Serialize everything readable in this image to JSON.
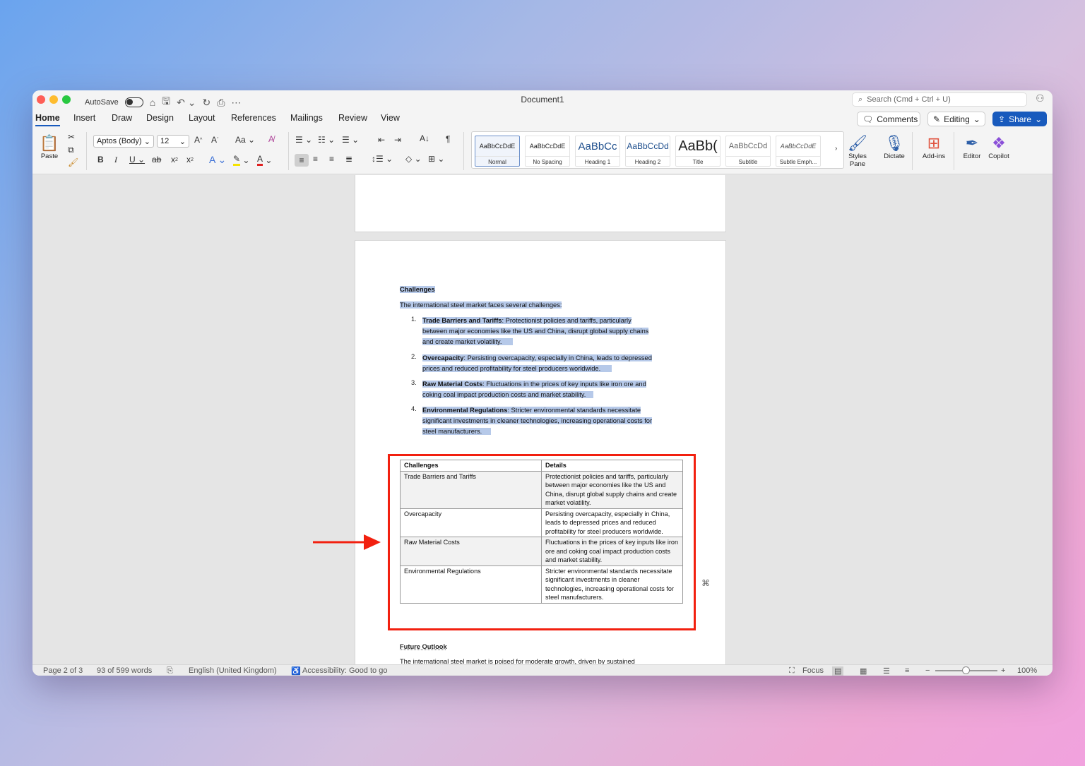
{
  "window": {
    "title": "Document1",
    "autosave_label": "AutoSave",
    "search_placeholder": "Search (Cmd + Ctrl + U)"
  },
  "menu": {
    "tabs": [
      "Home",
      "Insert",
      "Draw",
      "Design",
      "Layout",
      "References",
      "Mailings",
      "Review",
      "View"
    ],
    "comments_label": "Comments",
    "editing_label": "Editing",
    "share_label": "Share"
  },
  "ribbon": {
    "paste_label": "Paste",
    "font_name": "Aptos (Body)",
    "font_size": "12",
    "case_label": "Aa",
    "styles": [
      {
        "preview": "AaBbCcDdE",
        "label": "Normal"
      },
      {
        "preview": "AaBbCcDdE",
        "label": "No Spacing"
      },
      {
        "preview": "AaBbCc",
        "label": "Heading 1"
      },
      {
        "preview": "AaBbCcDd",
        "label": "Heading 2"
      },
      {
        "preview": "AaBb(",
        "label": "Title"
      },
      {
        "preview": "AaBbCcDd",
        "label": "Subtitle"
      },
      {
        "preview": "AaBbCcDdE",
        "label": "Subtle Emph..."
      }
    ],
    "styles_pane_label": "Styles Pane",
    "dictate_label": "Dictate",
    "addins_label": "Add-ins",
    "editor_label": "Editor",
    "copilot_label": "Copilot"
  },
  "document": {
    "heading": "Challenges",
    "intro": "The international steel market faces several challenges:",
    "list": [
      {
        "num": "1.",
        "bold": "Trade Barriers and Tariffs",
        "lines": [
          ": Protectionist policies and tariffs, particularly",
          "between major economies like the US and China, disrupt global supply chains",
          "and create market volatility."
        ]
      },
      {
        "num": "2.",
        "bold": "Overcapacity",
        "lines": [
          ": Persisting overcapacity, especially in China, leads to depressed",
          "prices and reduced profitability for steel producers worldwide."
        ]
      },
      {
        "num": "3.",
        "bold": "Raw Material Costs",
        "lines": [
          ": Fluctuations in the prices of key inputs like iron ore and",
          "coking coal impact production costs and market stability."
        ]
      },
      {
        "num": "4.",
        "bold": "Environmental Regulations",
        "lines": [
          ": Stricter environmental standards necessitate",
          "significant investments in cleaner technologies, increasing operational costs for",
          "steel manufacturers."
        ]
      }
    ],
    "table": {
      "headers": [
        "Challenges",
        "Details"
      ],
      "rows": [
        [
          "Trade Barriers and Tariffs",
          "Protectionist policies and tariffs, particularly between major economies like the US and China, disrupt global supply chains and create market volatility."
        ],
        [
          "Overcapacity",
          "Persisting overcapacity, especially in China, leads to depressed prices and reduced profitability for steel producers worldwide."
        ],
        [
          "Raw Material Costs",
          "Fluctuations in the prices of key inputs like iron ore and coking coal impact production costs and market stability."
        ],
        [
          "Environmental Regulations",
          "Stricter environmental standards necessitate significant investments in cleaner technologies, increasing operational costs for steel manufacturers."
        ]
      ]
    },
    "future_heading": "Future Outlook",
    "future_text": "The international steel market is poised for moderate growth, driven by sustained"
  },
  "status": {
    "page": "Page 2 of 3",
    "words": "93 of 599 words",
    "language": "English (United Kingdom)",
    "accessibility": "Accessibility: Good to go",
    "focus": "Focus",
    "zoom": "100%"
  },
  "annotation": {
    "box_color": "#f2200f",
    "arrow_color": "#f2200f"
  }
}
